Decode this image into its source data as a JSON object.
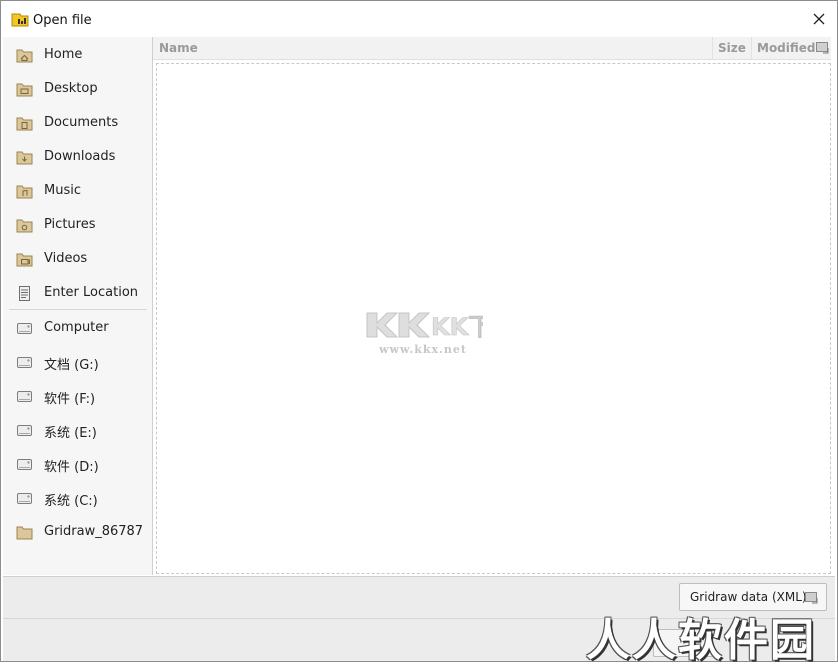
{
  "window": {
    "title": "Open file"
  },
  "sidebar": {
    "items": [
      {
        "label": "Home",
        "icon": "home-folder-icon"
      },
      {
        "label": "Desktop",
        "icon": "desktop-folder-icon"
      },
      {
        "label": "Documents",
        "icon": "documents-folder-icon"
      },
      {
        "label": "Downloads",
        "icon": "downloads-folder-icon"
      },
      {
        "label": "Music",
        "icon": "music-folder-icon"
      },
      {
        "label": "Pictures",
        "icon": "pictures-folder-icon"
      },
      {
        "label": "Videos",
        "icon": "videos-folder-icon"
      },
      {
        "label": "Enter Location",
        "icon": "location-icon"
      }
    ],
    "drives": [
      {
        "label": "Computer",
        "icon": "drive-icon"
      },
      {
        "label": "文档 (G:)",
        "icon": "drive-icon"
      },
      {
        "label": "软件 (F:)",
        "icon": "drive-icon"
      },
      {
        "label": "系统 (E:)",
        "icon": "drive-icon"
      },
      {
        "label": "软件 (D:)",
        "icon": "drive-icon"
      },
      {
        "label": "系统 (C:)",
        "icon": "drive-icon"
      },
      {
        "label": "Gridraw_86787",
        "icon": "folder-icon"
      }
    ]
  },
  "file_list": {
    "columns": {
      "name": "Name",
      "size": "Size",
      "modified": "Modified"
    },
    "rows": []
  },
  "filter": {
    "selected": "Gridraw data (XML)"
  },
  "watermarks": {
    "center_logo": "KK下载",
    "center_url": "www.kkx.net",
    "corner": "人人软件园"
  },
  "colors": {
    "folder": "#d8c49a",
    "folder_dark": "#a8915f",
    "header_text": "#9a9a9a"
  }
}
